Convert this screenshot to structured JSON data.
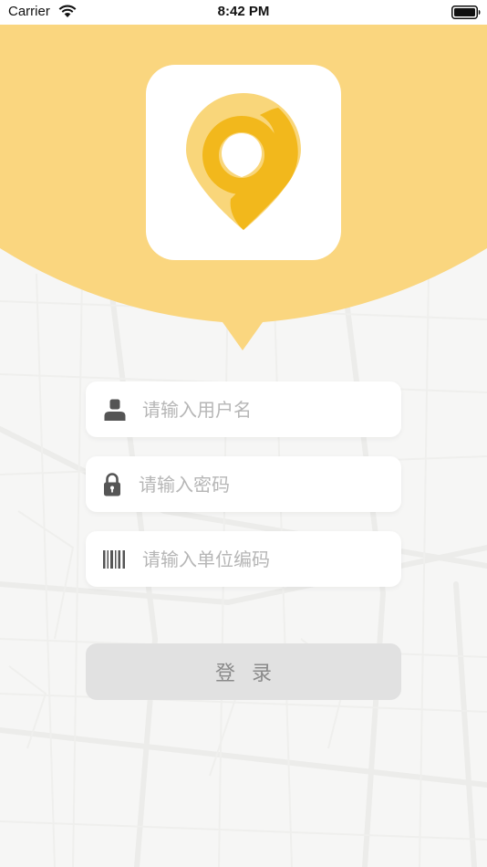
{
  "status_bar": {
    "carrier": "Carrier",
    "time": "8:42 PM"
  },
  "header": {
    "color": "#fad67f",
    "logo_colors": {
      "light": "#f9d67a",
      "dark": "#f2b81c"
    }
  },
  "form": {
    "username": {
      "placeholder": "请输入用户名",
      "value": "",
      "icon": "user-icon"
    },
    "password": {
      "placeholder": "请输入密码",
      "value": "",
      "icon": "lock-icon"
    },
    "unit_code": {
      "placeholder": "请输入单位编码",
      "value": "",
      "icon": "barcode-icon"
    },
    "login_label": "登录"
  }
}
